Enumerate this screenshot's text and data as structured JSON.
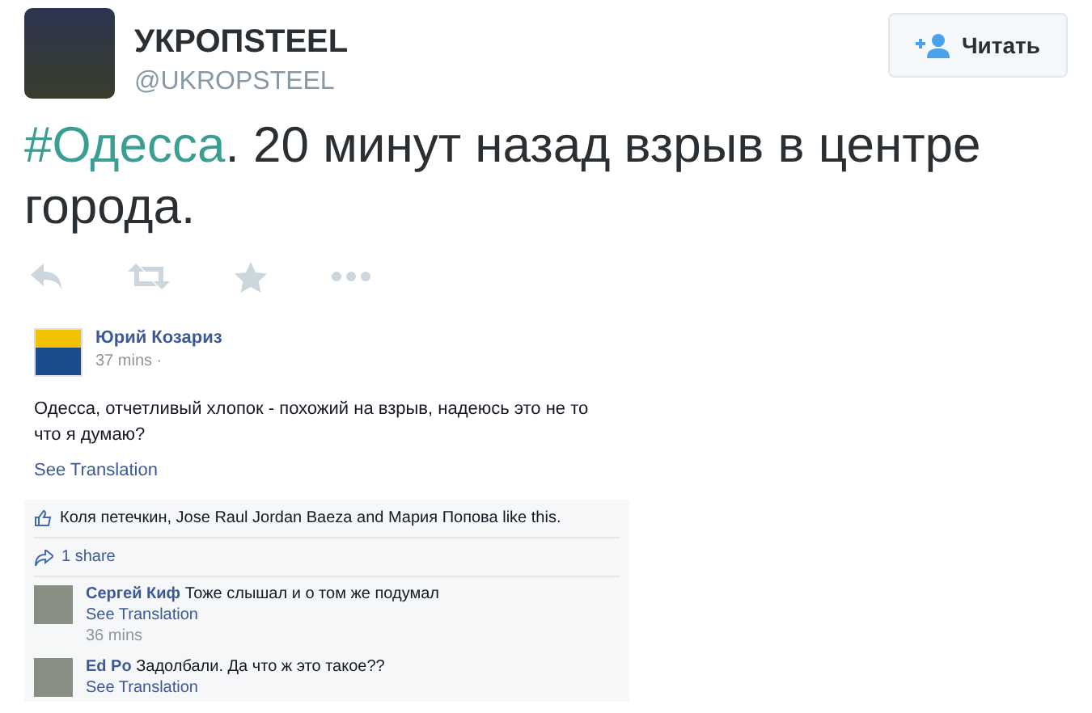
{
  "author": {
    "name": "УКРОПSTEEL",
    "handle": "@UKROPSTEEL"
  },
  "follow_button": {
    "label": "Читать"
  },
  "tweet": {
    "hashtag": "#Одесса",
    "text": ". 20 минут назад взрыв в центре города."
  },
  "embedded_post": {
    "author": "Юрий Козариз",
    "time": "37 mins ·",
    "text": "Одесса, отчетливый хлопок - похожий на взрыв, надеюсь это не то что я думаю?",
    "translation_link": "See Translation",
    "likes": "Коля петечкин, Jose Raul Jordan Baeza and Мария Попова like this.",
    "shares": "1 share",
    "comments": [
      {
        "author": "Сергей Киф",
        "text": "Тоже слышал и о том же подумал",
        "translation_link": "See Translation",
        "time": "36 mins"
      },
      {
        "author": "Ed Po",
        "text": "Задолбали. Да что ж это такое??",
        "translation_link": "See Translation"
      }
    ]
  }
}
